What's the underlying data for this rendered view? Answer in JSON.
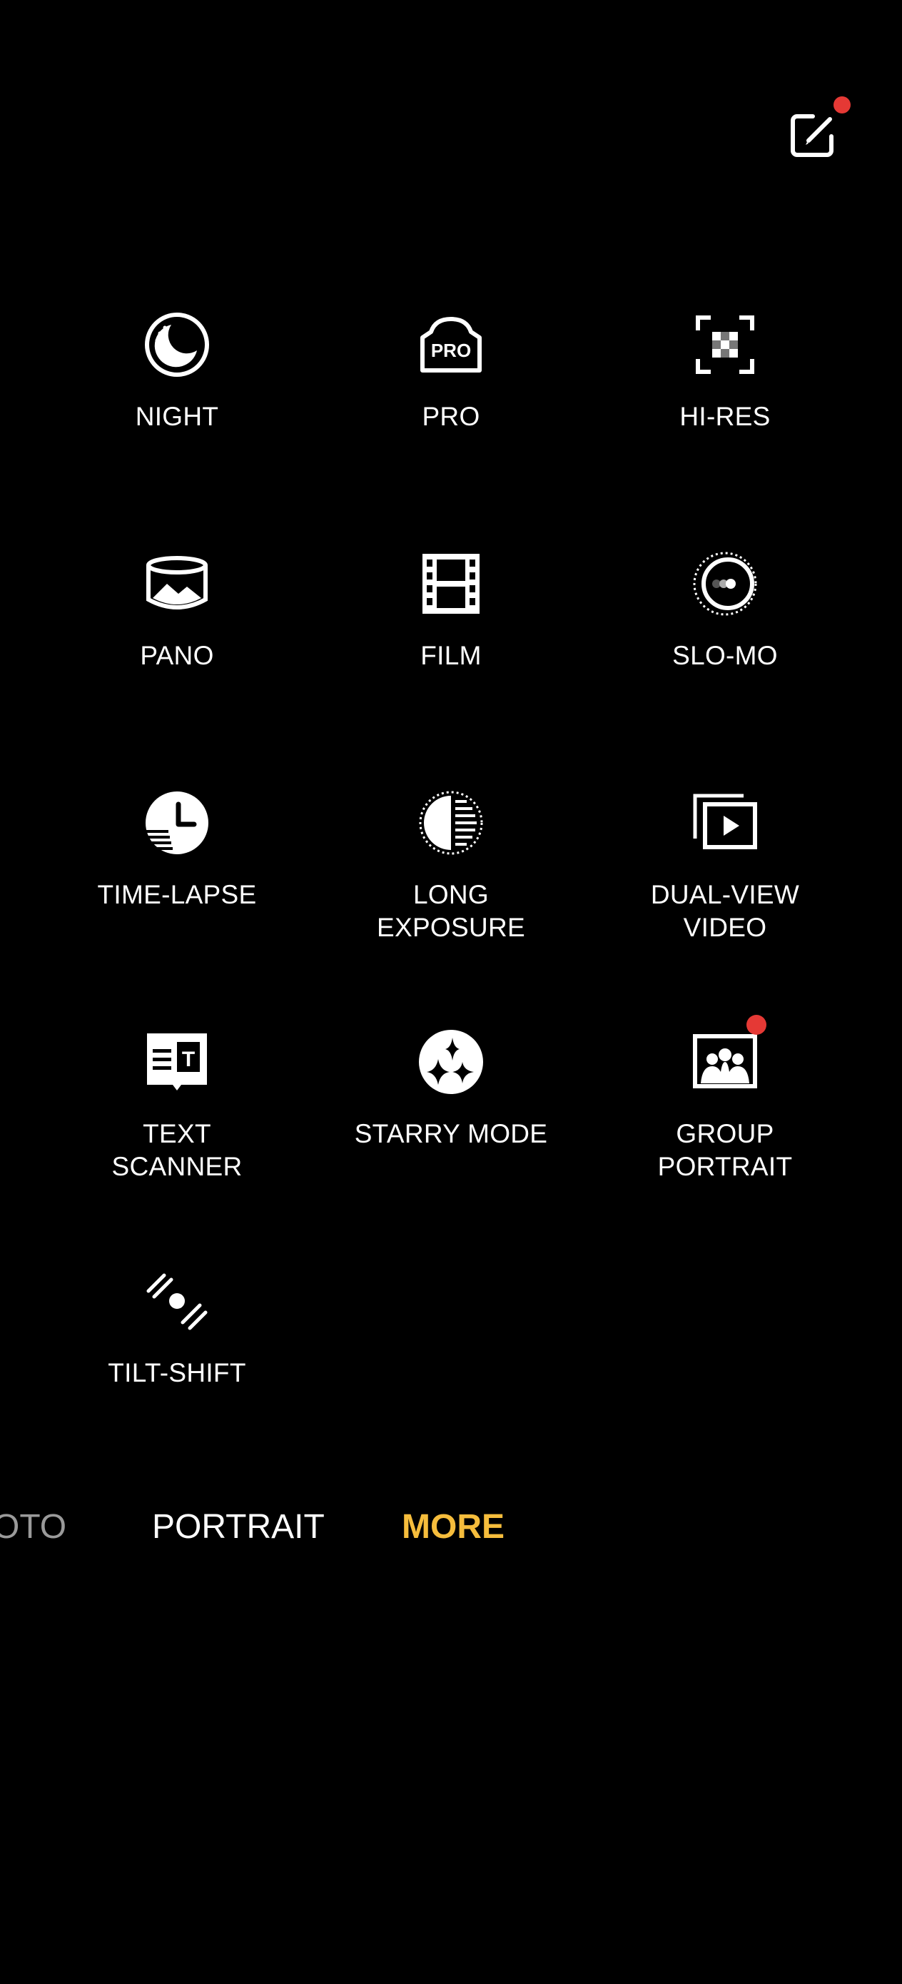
{
  "header": {
    "edit_icon": "edit-square-icon",
    "edit_badge": true
  },
  "modes": [
    {
      "key": "night",
      "label": "NIGHT",
      "icon": "night-moon-icon",
      "badge": false
    },
    {
      "key": "pro",
      "label": "PRO",
      "icon": "pro-camera-icon",
      "icon_text": "PRO",
      "badge": false
    },
    {
      "key": "hi-res",
      "label": "HI-RES",
      "icon": "hi-res-grid-icon",
      "badge": false
    },
    {
      "key": "pano",
      "label": "PANO",
      "icon": "panorama-icon",
      "badge": false
    },
    {
      "key": "film",
      "label": "FILM",
      "icon": "film-strip-icon",
      "badge": false
    },
    {
      "key": "slo-mo",
      "label": "SLO-MO",
      "icon": "slow-motion-icon",
      "badge": false
    },
    {
      "key": "time-lapse",
      "label": "TIME-LAPSE",
      "icon": "time-lapse-clock-icon",
      "badge": false
    },
    {
      "key": "long-exposure",
      "label": "LONG\nEXPOSURE",
      "icon": "long-exposure-icon",
      "badge": false
    },
    {
      "key": "dual-view-video",
      "label": "DUAL-VIEW\nVIDEO",
      "icon": "dual-view-video-icon",
      "badge": false
    },
    {
      "key": "text-scanner",
      "label": "TEXT\nSCANNER",
      "icon": "text-scanner-icon",
      "icon_text": "T",
      "badge": false
    },
    {
      "key": "starry-mode",
      "label": "STARRY MODE",
      "icon": "starry-sparkle-icon",
      "badge": false
    },
    {
      "key": "group-portrait",
      "label": "GROUP\nPORTRAIT",
      "icon": "group-portrait-icon",
      "badge": true
    },
    {
      "key": "tilt-shift",
      "label": "TILT-SHIFT",
      "icon": "tilt-shift-icon",
      "badge": false
    }
  ],
  "tabs": {
    "partial_label": "OTO",
    "portrait_label": "PORTRAIT",
    "more_label": "MORE",
    "active": "MORE"
  },
  "colors": {
    "background": "#000000",
    "text": "#ffffff",
    "active_tab": "#f6bd3c",
    "badge": "#e53935",
    "inactive_tab": "#9a9a9a"
  }
}
